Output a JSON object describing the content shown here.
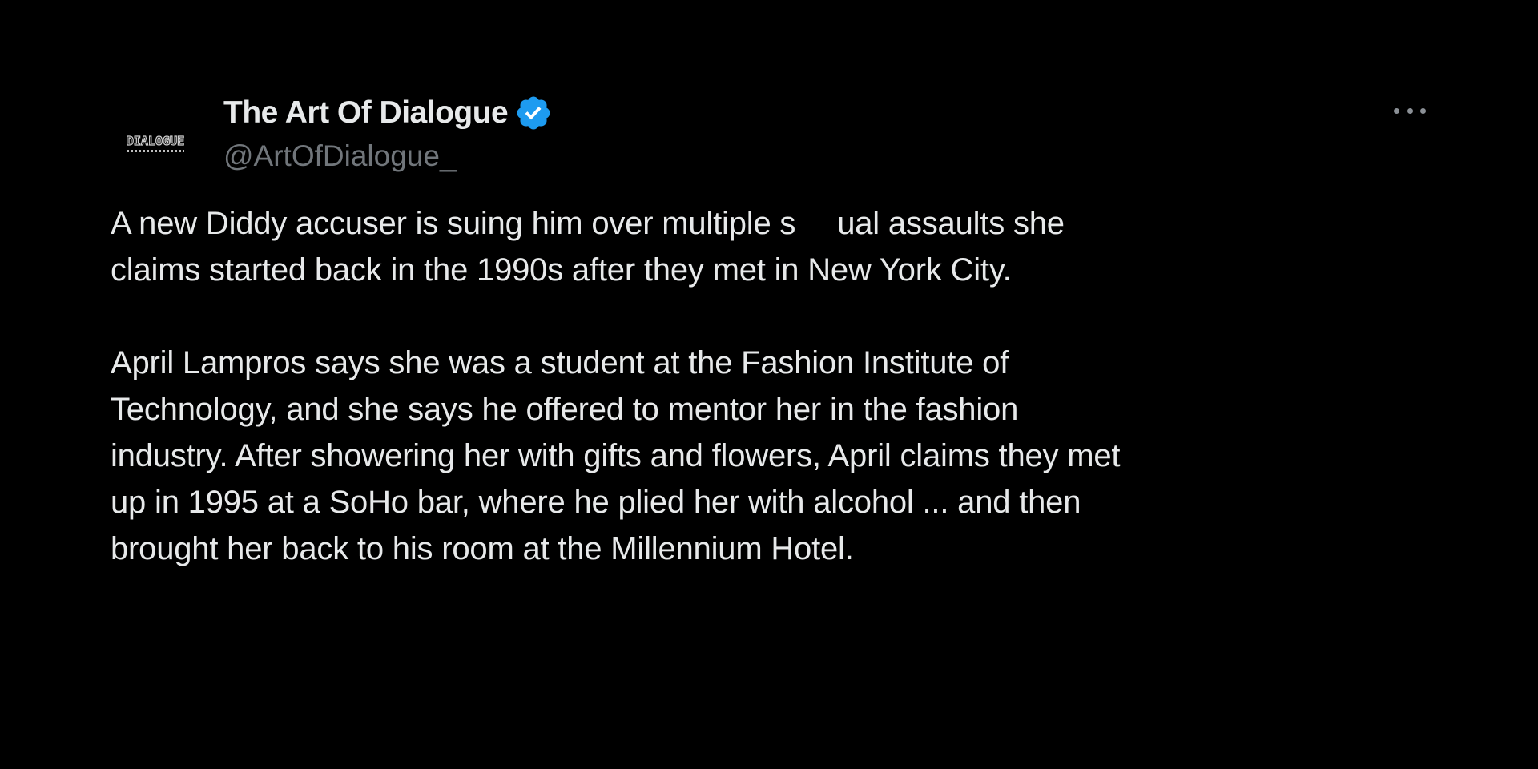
{
  "author": {
    "avatar_text": "DIALOGUE",
    "display_name": "The Art Of Dialogue",
    "handle": "@ArtOfDialogue_",
    "verified_color": "#1d9bf0"
  },
  "tweet": {
    "paragraph1": {
      "line1_part1": "A new Diddy accuser is suing him over multiple s",
      "line1_part2": "ual assaults she",
      "line2": "claims started back in the 1990s after they met in New York City."
    },
    "paragraph2": {
      "line1": "April Lampros says she was a student at the Fashion Institute of",
      "line2": "Technology, and she says he offered to mentor her in the fashion",
      "line3": "industry. After showering her with gifts and flowers, April claims they met",
      "line4": "up in 1995 at a SoHo bar, where he plied her with alcohol ... and then",
      "line5": "brought her back to his room at the Millennium Hotel."
    }
  },
  "icons": {
    "verified": "verified-badge-icon",
    "more": "more-options-icon"
  },
  "colors": {
    "background": "#000000",
    "text": "#e7e9ea",
    "secondary_text": "#71767b"
  }
}
